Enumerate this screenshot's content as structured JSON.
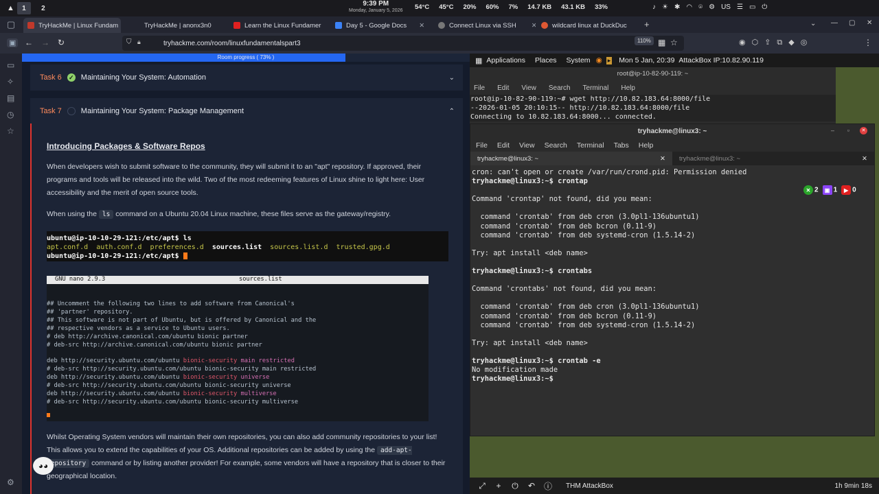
{
  "sysbar": {
    "workspaces": [
      "1",
      "2"
    ],
    "time": "9:39 PM",
    "date": "Monday, January 5, 2026",
    "stats": [
      "54°C",
      "45°C",
      "20%",
      "60%",
      "7%",
      "14.7 KB",
      "43.1 KB",
      "33%"
    ],
    "tray_lang": "US"
  },
  "tabs": [
    {
      "label": "TryHackMe | Linux Fundam",
      "color": "#c0392b"
    },
    {
      "label": "TryHackMe | anonx3n0",
      "color": "#c0392b"
    },
    {
      "label": "Learn the Linux Fundamer",
      "color": "#e02020"
    },
    {
      "label": "Day 5 - Google Docs",
      "color": "#3b82f6"
    },
    {
      "label": "Connect Linux via SSH",
      "color": "#888888"
    },
    {
      "label": "wildcard linux at DuckDuc",
      "color": "#de5833"
    }
  ],
  "url": "tryhackme.com/room/linuxfundamentalspart3",
  "zoom": "110%",
  "progress": {
    "label": "Room progress ( 73% )",
    "value": 73
  },
  "task6": {
    "num": "Task 6",
    "title": "Maintaining Your System: Automation"
  },
  "task7": {
    "num": "Task 7",
    "title": "Maintaining Your System: Package Management"
  },
  "content": {
    "heading": "Introducing Packages & Software Repos",
    "p1": "When developers wish to submit software to the community, they will submit it to an  \"apt\" repository. If approved, their programs and tools will be released into the wild. Two of the most redeeming features of Linux shine to light here: User accessibility and the merit of open source tools.",
    "p2_pre": "When using the ",
    "p2_code": "ls",
    "p2_post": " command on a Ubuntu 20.04 Linux machine, these files serve as the gateway/registry.",
    "term_line1": "ubuntu@ip-10-10-29-121:/etc/apt$ ls",
    "term_files": [
      "apt.conf.d",
      "auth.conf.d",
      "preferences.d",
      "sources.list",
      "sources.list.d",
      "trusted.gpg.d"
    ],
    "term_line3": "ubuntu@ip-10-10-29-121:/etc/apt$ ",
    "nano_version": "GNU nano 2.9.3",
    "nano_file": "sources.list",
    "nano_comments": [
      "## Uncomment the following two lines to add software from Canonical's",
      "## 'partner' repository.",
      "## This software is not part of Ubuntu, but is offered by Canonical and the",
      "## respective vendors as a service to Ubuntu users.",
      "# deb http://archive.canonical.com/ubuntu bionic partner",
      "# deb-src http://archive.canonical.com/ubuntu bionic partner"
    ],
    "nano_lines": [
      {
        "a": "deb http://security.ubuntu.com/ubuntu ",
        "b": "bionic-security",
        "c": " main restricted"
      },
      {
        "a": "# deb-src http://security.ubuntu.com/ubuntu bionic-security main restricted",
        "b": "",
        "c": ""
      },
      {
        "a": "deb http://security.ubuntu.com/ubuntu ",
        "b": "bionic-security",
        "c": " universe"
      },
      {
        "a": "# deb-src http://security.ubuntu.com/ubuntu bionic-security universe",
        "b": "",
        "c": ""
      },
      {
        "a": "deb http://security.ubuntu.com/ubuntu ",
        "b": "bionic-security",
        "c": " multiverse"
      },
      {
        "a": "# deb-src http://security.ubuntu.com/ubuntu bionic-security multiverse",
        "b": "",
        "c": ""
      }
    ],
    "p3_pre": "Whilst Operating System vendors will maintain their own repositories, you can also add community repositories to your list! This allows you to extend the capabilities of your OS. Additional repositories can be added by using the ",
    "p3_code": "add-apt-repository",
    "p3_post": " command or by listing another provider! For example, some vendors will have a repository that is closer to their geographical location."
  },
  "desktop": {
    "menu": [
      "Applications",
      "Places",
      "System"
    ],
    "datetime": "Mon 5 Jan, 20:39",
    "attackbox": "AttackBox IP:10.82.90.119",
    "back_title": "root@ip-10-82-90-119: ~",
    "back_menu": [
      "File",
      "Edit",
      "View",
      "Search",
      "Terminal",
      "Help"
    ],
    "back_lines": [
      "root@ip-10-82-90-119:~# wget http://10.82.183.64:8000/file",
      "--2026-01-05 20:10:15--  http://10.82.183.64:8000/file",
      "Connecting to 10.82.183.64:8000... connected."
    ],
    "front_title": "tryhackme@linux3: ~",
    "front_menu": [
      "File",
      "Edit",
      "View",
      "Search",
      "Terminal",
      "Tabs",
      "Help"
    ],
    "front_tabs": [
      "tryhackme@linux3: ~",
      "tryhackme@linux3: ~"
    ],
    "front_lines": [
      "cron: can't open or create /var/run/crond.pid: Permission denied",
      "tryhackme@linux3:~$ crontap",
      "",
      "Command 'crontap' not found, did you mean:",
      "",
      "  command 'crontab' from deb cron (3.0pl1-136ubuntu1)",
      "  command 'crontab' from deb bcron (0.11-9)",
      "  command 'crontab' from deb systemd-cron (1.5.14-2)",
      "",
      "Try: apt install <deb name>",
      "",
      "tryhackme@linux3:~$ crontabs",
      "",
      "Command 'crontabs' not found, did you mean:",
      "",
      "  command 'crontab' from deb cron (3.0pl1-136ubuntu1)",
      "  command 'crontab' from deb bcron (0.11-9)",
      "  command 'crontab' from deb systemd-cron (1.5.14-2)",
      "",
      "Try: apt install <deb name>",
      "",
      "tryhackme@linux3:~$ crontab -e",
      "No modification made",
      "tryhackme@linux3:~$ "
    ],
    "badges": [
      "2",
      "1",
      "0"
    ],
    "dock_label": "THM AttackBox",
    "timer": "1h 9min 18s"
  }
}
